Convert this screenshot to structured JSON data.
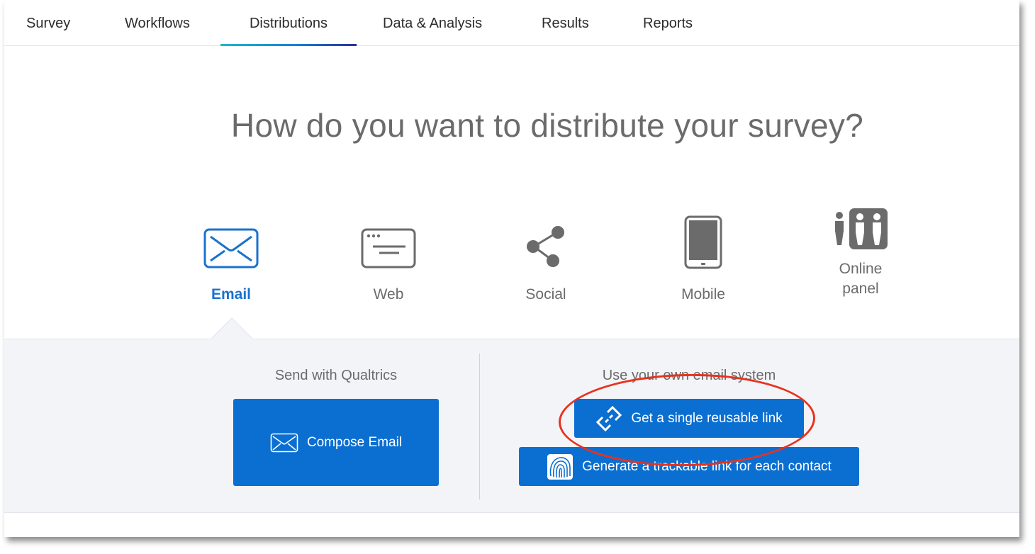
{
  "nav": {
    "tabs": [
      {
        "label": "Survey",
        "active": false
      },
      {
        "label": "Workflows",
        "active": false
      },
      {
        "label": "Distributions",
        "active": true
      },
      {
        "label": "Data & Analysis",
        "active": false
      },
      {
        "label": "Results",
        "active": false
      },
      {
        "label": "Reports",
        "active": false
      }
    ]
  },
  "headline": "How do you want to distribute your survey?",
  "methods": [
    {
      "label": "Email",
      "icon": "envelope-icon",
      "active": true
    },
    {
      "label": "Web",
      "icon": "browser-window-icon",
      "active": false
    },
    {
      "label": "Social",
      "icon": "share-icon",
      "active": false
    },
    {
      "label": "Mobile",
      "icon": "tablet-icon",
      "active": false
    },
    {
      "label_line1": "Online",
      "label_line2": "panel",
      "icon": "people-panel-icon",
      "active": false
    }
  ],
  "email_panel": {
    "qualtrics": {
      "title": "Send with Qualtrics",
      "compose_label": "Compose Email",
      "compose_icon": "envelope-icon"
    },
    "own_system": {
      "title": "Use your own email system",
      "reusable_link_label": "Get a single reusable link",
      "reusable_link_icon": "link-icon",
      "trackable_link_label": "Generate a trackable link for each contact",
      "trackable_link_icon": "fingerprint-icon"
    }
  },
  "colors": {
    "accent": "#0b6fd1",
    "active_label": "#1a72cf",
    "annotation": "#e8321e",
    "panel_bg": "#f3f4f8"
  }
}
